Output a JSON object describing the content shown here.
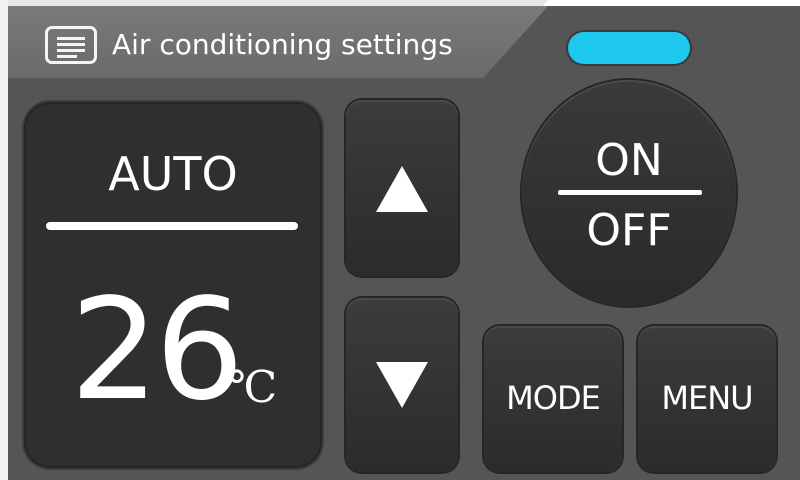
{
  "header": {
    "title": "Air conditioning settings",
    "settings_icon": "settings-list-icon",
    "status_indicator_color": "#1ec8ef"
  },
  "display": {
    "mode": "AUTO",
    "temperature": "26",
    "unit": "℃"
  },
  "controls": {
    "up_icon": "triangle-up-icon",
    "down_icon": "triangle-down-icon",
    "power_on_label": "ON",
    "power_off_label": "OFF",
    "mode_label": "MODE",
    "menu_label": "MENU"
  },
  "colors": {
    "panel_background": "#555555",
    "button_background": "#2f2f2f",
    "text": "#ffffff"
  }
}
